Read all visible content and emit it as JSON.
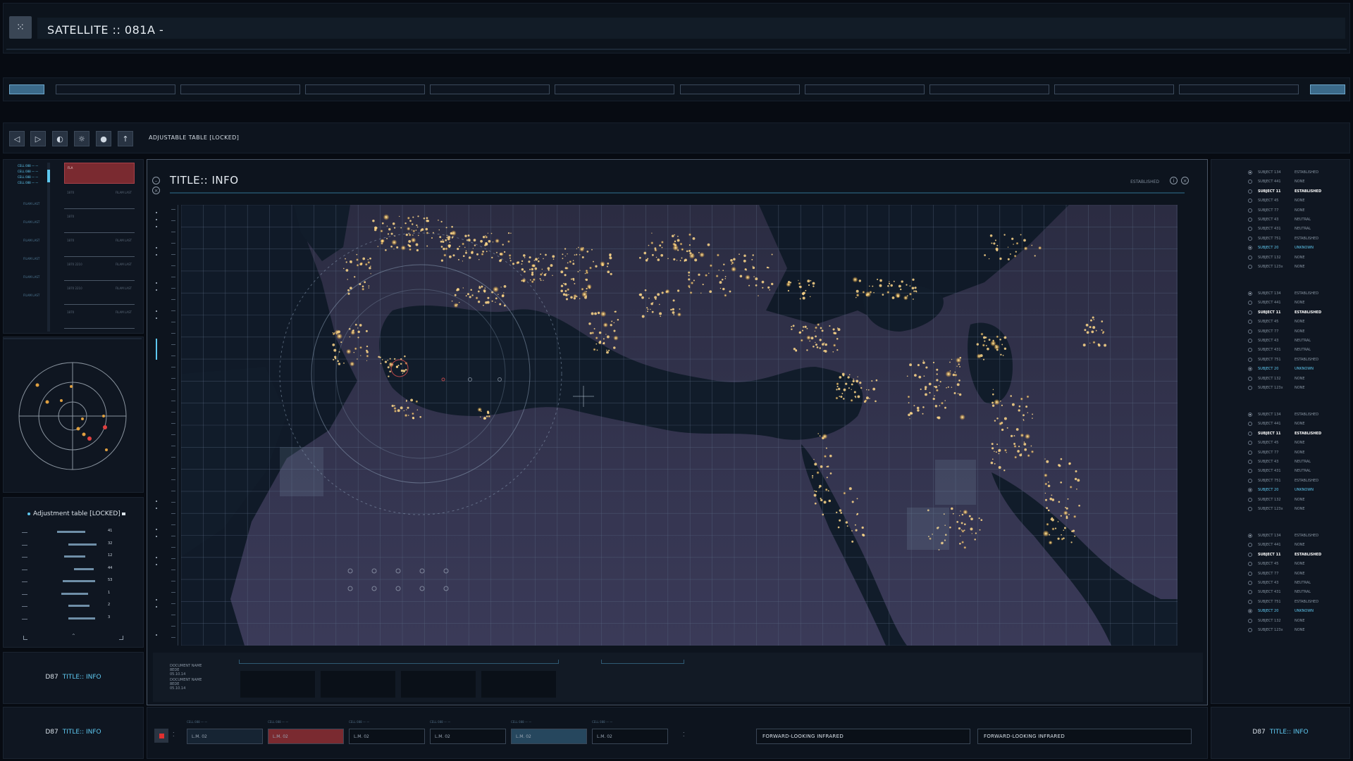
{
  "app_title": "SATELLITE :: 081A -",
  "toolbar": {
    "label": "ADJUSTABLE TABLE  [LOCKED]",
    "buttons": [
      "prev-icon",
      "next-icon",
      "contrast-icon",
      "brightness-icon",
      "target-icon",
      "pin-icon"
    ]
  },
  "tabs": {
    "count": 12,
    "active": [
      0,
      11
    ]
  },
  "left_top": {
    "header_items": [
      "CELL 088 — —",
      "CELL 088 — —",
      "CELL 088 — —",
      "CELL 088 — —"
    ],
    "side_labels": [
      "FILAM LAST",
      "FILAM LAST",
      "FILAM LAST",
      "FILAM LAST",
      "FILAM LAST",
      "FILAM LAST"
    ],
    "alert_label": "FLA",
    "rows": [
      {
        "left": "1870",
        "right": "FILAM LAST"
      },
      {
        "left": "1870",
        "right": ""
      },
      {
        "left": "1870",
        "right": "FILAM LAST"
      },
      {
        "left": "1870 2210",
        "right": "FILAM LAST"
      },
      {
        "left": "1870 2210",
        "right": "FILAM LAST"
      },
      {
        "left": "1870",
        "right": "FILAM LAST"
      }
    ]
  },
  "adjustment": {
    "title": "Adjustment table [LOCKED]",
    "values": [
      "41",
      "32",
      "12",
      "44",
      "53",
      "1",
      "2",
      "3"
    ]
  },
  "info_panels": [
    {
      "code": "D87",
      "title": "TITLE:: INFO"
    },
    {
      "code": "D87",
      "title": "TITLE:: INFO"
    },
    {
      "code": "D87",
      "title": "TITLE:: INFO"
    }
  ],
  "main": {
    "title": "TITLE:: INFO",
    "status": "ESTABLISHED",
    "map_label": "map-night-lights",
    "documents": [
      {
        "name": "DOCUMENT NAME",
        "code": "8EDE",
        "date": "05.10.14"
      },
      {
        "name": "DOCUMENT NAME",
        "code": "8EDE",
        "date": "05.10.14"
      }
    ]
  },
  "subject_groups": [
    [
      {
        "name": "SUBJECT 134",
        "value": "ESTABLISHED",
        "state": "on"
      },
      {
        "name": "SUBJECT 441",
        "value": "NONE",
        "state": ""
      },
      {
        "name": "SUBJECT 11",
        "value": "ESTABLISHED",
        "state": "hl"
      },
      {
        "name": "SUBJECT 45",
        "value": "NONE",
        "state": ""
      },
      {
        "name": "SUBJECT 77",
        "value": "NONE",
        "state": ""
      },
      {
        "name": "SUBJECT 43",
        "value": "NEUTRAL",
        "state": ""
      },
      {
        "name": "SUBJECT 431",
        "value": "NEUTRAL",
        "state": ""
      },
      {
        "name": "SUBJECT 751",
        "value": "ESTABLISHED",
        "state": ""
      },
      {
        "name": "SUBJECT 20",
        "value": "UNKNOWN",
        "state": "sel"
      },
      {
        "name": "SUBJECT 132",
        "value": "NONE",
        "state": ""
      },
      {
        "name": "SUBJECT 123x",
        "value": "NONE",
        "state": ""
      }
    ],
    [
      {
        "name": "SUBJECT 134",
        "value": "ESTABLISHED",
        "state": "on"
      },
      {
        "name": "SUBJECT 441",
        "value": "NONE",
        "state": ""
      },
      {
        "name": "SUBJECT 11",
        "value": "ESTABLISHED",
        "state": "hl"
      },
      {
        "name": "SUBJECT 45",
        "value": "NONE",
        "state": ""
      },
      {
        "name": "SUBJECT 77",
        "value": "NONE",
        "state": ""
      },
      {
        "name": "SUBJECT 43",
        "value": "NEUTRAL",
        "state": ""
      },
      {
        "name": "SUBJECT 431",
        "value": "NEUTRAL",
        "state": ""
      },
      {
        "name": "SUBJECT 751",
        "value": "ESTABLISHED",
        "state": ""
      },
      {
        "name": "SUBJECT 20",
        "value": "UNKNOWN",
        "state": "sel"
      },
      {
        "name": "SUBJECT 132",
        "value": "NONE",
        "state": ""
      },
      {
        "name": "SUBJECT 123x",
        "value": "NONE",
        "state": ""
      }
    ],
    [
      {
        "name": "SUBJECT 134",
        "value": "ESTABLISHED",
        "state": "on"
      },
      {
        "name": "SUBJECT 441",
        "value": "NONE",
        "state": ""
      },
      {
        "name": "SUBJECT 11",
        "value": "ESTABLISHED",
        "state": "hl"
      },
      {
        "name": "SUBJECT 45",
        "value": "NONE",
        "state": ""
      },
      {
        "name": "SUBJECT 77",
        "value": "NONE",
        "state": ""
      },
      {
        "name": "SUBJECT 43",
        "value": "NEUTRAL",
        "state": ""
      },
      {
        "name": "SUBJECT 431",
        "value": "NEUTRAL",
        "state": ""
      },
      {
        "name": "SUBJECT 751",
        "value": "ESTABLISHED",
        "state": ""
      },
      {
        "name": "SUBJECT 20",
        "value": "UNKNOWN",
        "state": "sel"
      },
      {
        "name": "SUBJECT 132",
        "value": "NONE",
        "state": ""
      },
      {
        "name": "SUBJECT 123x",
        "value": "NONE",
        "state": ""
      }
    ],
    [
      {
        "name": "SUBJECT 134",
        "value": "ESTABLISHED",
        "state": "on"
      },
      {
        "name": "SUBJECT 441",
        "value": "NONE",
        "state": ""
      },
      {
        "name": "SUBJECT 11",
        "value": "ESTABLISHED",
        "state": "hl"
      },
      {
        "name": "SUBJECT 45",
        "value": "NONE",
        "state": ""
      },
      {
        "name": "SUBJECT 77",
        "value": "NONE",
        "state": ""
      },
      {
        "name": "SUBJECT 43",
        "value": "NEUTRAL",
        "state": ""
      },
      {
        "name": "SUBJECT 431",
        "value": "NEUTRAL",
        "state": ""
      },
      {
        "name": "SUBJECT 751",
        "value": "ESTABLISHED",
        "state": ""
      },
      {
        "name": "SUBJECT 20",
        "value": "UNKNOWN",
        "state": "sel"
      },
      {
        "name": "SUBJECT 132",
        "value": "NONE",
        "state": ""
      },
      {
        "name": "SUBJECT 123x",
        "value": "NONE",
        "state": ""
      }
    ]
  ],
  "bottom": {
    "lm_boxes": [
      {
        "caption": "CELL 088 — —",
        "label": "L.M. 02",
        "style": "dark"
      },
      {
        "caption": "CELL 088 — —",
        "label": "L.M. 02",
        "style": "red"
      },
      {
        "caption": "CELL 088 — —",
        "label": "L.M. 02",
        "style": "plain"
      },
      {
        "caption": "CELL 088 — —",
        "label": "L.M. 02",
        "style": "plain"
      },
      {
        "caption": "CELL 088 — —",
        "label": "L.M. 02",
        "style": "blue"
      },
      {
        "caption": "CELL 088 — —",
        "label": "L.M. 02",
        "style": "plain"
      }
    ],
    "flir": [
      "FORWARD-LOOKING INFRARED",
      "FORWARD-LOOKING INFRARED"
    ]
  },
  "colors": {
    "accent": "#5ec8f0",
    "alert": "#7a2a30",
    "panel": "#0f1621",
    "city_lights": "#ffd88a"
  }
}
